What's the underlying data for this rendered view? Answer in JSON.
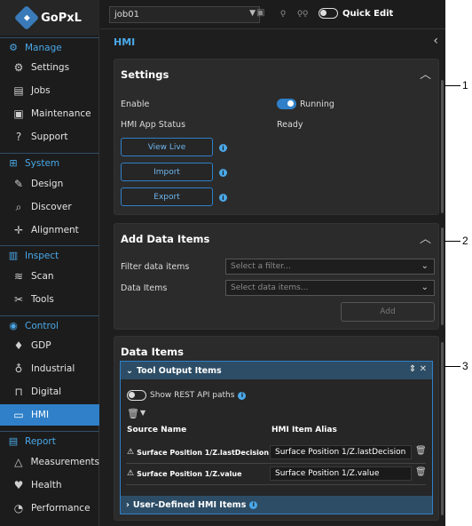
{
  "brand": {
    "name": "GoPxL"
  },
  "sidebar": {
    "sections": [
      {
        "label": "Manage",
        "icon": "manage-icon"
      },
      {
        "label": "System",
        "icon": "system-icon"
      },
      {
        "label": "Inspect",
        "icon": "inspect-icon"
      },
      {
        "label": "Control",
        "icon": "control-icon"
      },
      {
        "label": "Report",
        "icon": "report-icon"
      }
    ],
    "items": [
      {
        "label": "Settings",
        "icon": "gear-icon"
      },
      {
        "label": "Jobs",
        "icon": "jobs-icon"
      },
      {
        "label": "Maintenance",
        "icon": "maintenance-icon"
      },
      {
        "label": "Support",
        "icon": "support-icon"
      },
      {
        "label": "Design",
        "icon": "design-icon"
      },
      {
        "label": "Discover",
        "icon": "discover-icon"
      },
      {
        "label": "Alignment",
        "icon": "alignment-icon"
      },
      {
        "label": "Scan",
        "icon": "scan-icon"
      },
      {
        "label": "Tools",
        "icon": "tools-icon"
      },
      {
        "label": "GDP",
        "icon": "gdp-icon"
      },
      {
        "label": "Industrial",
        "icon": "industrial-icon"
      },
      {
        "label": "Digital",
        "icon": "digital-icon"
      },
      {
        "label": "HMI",
        "icon": "hmi-icon",
        "active": true
      },
      {
        "label": "Measurements",
        "icon": "measurements-icon"
      },
      {
        "label": "Health",
        "icon": "health-icon"
      },
      {
        "label": "Performance",
        "icon": "performance-icon"
      }
    ]
  },
  "toolbar": {
    "job": "job01",
    "quick_edit": "Quick Edit"
  },
  "panel": {
    "title": "HMI"
  },
  "settings": {
    "title": "Settings",
    "enable_label": "Enable",
    "enable_state": "Running",
    "status_label": "HMI App Status",
    "status_value": "Ready",
    "buttons": [
      "View Live",
      "Import",
      "Export"
    ]
  },
  "add_data_items": {
    "title": "Add Data Items",
    "filter_label": "Filter data items",
    "filter_placeholder": "Select a filter...",
    "items_label": "Data Items",
    "items_placeholder": "Select data items...",
    "add_label": "Add"
  },
  "data_items": {
    "title": "Data Items",
    "tool_output": "Tool Output Items",
    "show_rest": "Show REST API paths",
    "col_source": "Source Name",
    "col_alias": "HMI Item Alias",
    "rows": [
      {
        "source": "Surface Position 1/Z.lastDecision",
        "alias": "Surface Position 1/Z.lastDecision"
      },
      {
        "source": "Surface Position 1/Z.value",
        "alias": "Surface Position 1/Z.value"
      }
    ],
    "user_defined": "User-Defined HMI Items"
  },
  "callouts": [
    "1",
    "2",
    "3"
  ],
  "colors": {
    "accent": "#2f80c8",
    "link": "#4aa8e8",
    "background": "#1e1e1e"
  }
}
